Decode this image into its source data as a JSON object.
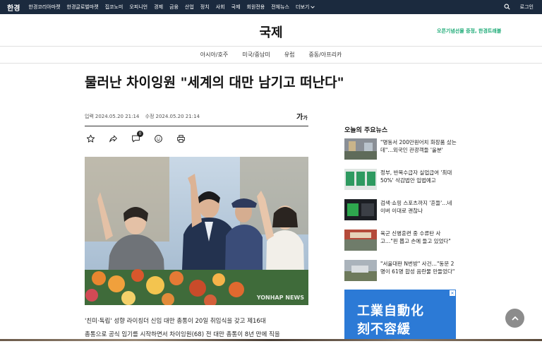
{
  "topbar": {
    "logo": "한경",
    "nav": [
      "한경코리아마켓",
      "한경글로벌마켓",
      "집코노미",
      "오피니언",
      "경제",
      "금융",
      "산업",
      "정치",
      "사회",
      "국제",
      "회원전용",
      "전체뉴스"
    ],
    "more": "더보기",
    "login": "로그인"
  },
  "section": {
    "title": "국제",
    "promo": "오픈기념선물 증정, 한경트래블"
  },
  "subnav": [
    "아시아/호주",
    "미국/중남미",
    "유럽",
    "중동/아프리카"
  ],
  "article": {
    "headline": "물러난 차이잉원 \"세계의 대만 남기고 떠난다\"",
    "input_label": "입력",
    "input_time": "2024.05.20 21:14",
    "edit_label": "수정",
    "edit_time": "2024.05.20 21:14",
    "font_btn_big": "가",
    "font_btn_small": "가",
    "comment_count": "0",
    "photo_credit": "YONHAP NEWS",
    "body": [
      "'친미·독립' 성향 라이칭더 신임 대만 총통이 20일 취임식을 갖고 제16대",
      "총통으로 공식 임기를 시작하면서 차이잉원(68) 전 대만 총통이 8년 만에 직을"
    ]
  },
  "sidebar": {
    "title": "오늘의 주요뉴스",
    "items": [
      {
        "text": "\"명동서 200만원어치 화장품 샀는데\"…외국인 관광객들 '울분'"
      },
      {
        "text": "정부, 반복수급자 실업급여 '최대 50%' 삭감법안 입법예고"
      },
      {
        "text": "검색·쇼핑 스포츠까지 '흔들'…네이버 이대로 괜찮나"
      },
      {
        "text": "육군 신병훈련 중 수류탄 사고…\"핀 뽑고 손에 들고 있었다\""
      },
      {
        "text": "\"서울대판 N번방\" 사건…\"동문 2명이 61명 합성 음란물 만들었다\""
      }
    ],
    "ad_line1": "工業自動化",
    "ad_line2": "刻不容緩"
  },
  "colors": {
    "topbar_bg": "#1b2a3e",
    "promo_green": "#19a974",
    "ad_blue": "#2c7ad6"
  }
}
